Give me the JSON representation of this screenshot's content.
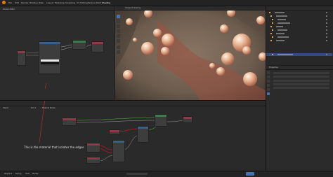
{
  "topbar": {
    "menus": [
      "File",
      "Edit",
      "Render",
      "Window",
      "Help",
      "Layout",
      "Modeling",
      "Sculpting",
      "UV Editing",
      "Texture Paint",
      "Shading"
    ]
  },
  "top_left_editor": {
    "title": "Shader Editor"
  },
  "viewport": {
    "title": "Viewport Shading"
  },
  "bottom_editor": {
    "header_left": "Object",
    "header_mid": "Slot 1",
    "header_right": "Material Nodes",
    "annotation": "This is the material that isolates the edges"
  },
  "status_bar": {
    "items": [
      "Playback",
      "Keying",
      "View",
      "Marker"
    ]
  },
  "properties": {
    "title": "Properties"
  },
  "colors": {
    "node_header_green": "#3b7e4c",
    "node_header_blue": "#3c5e8a",
    "node_header_red": "#8e3848",
    "wire_red": "#c01528",
    "wire_green": "#53c13b",
    "annotation_red": "#b03022"
  }
}
